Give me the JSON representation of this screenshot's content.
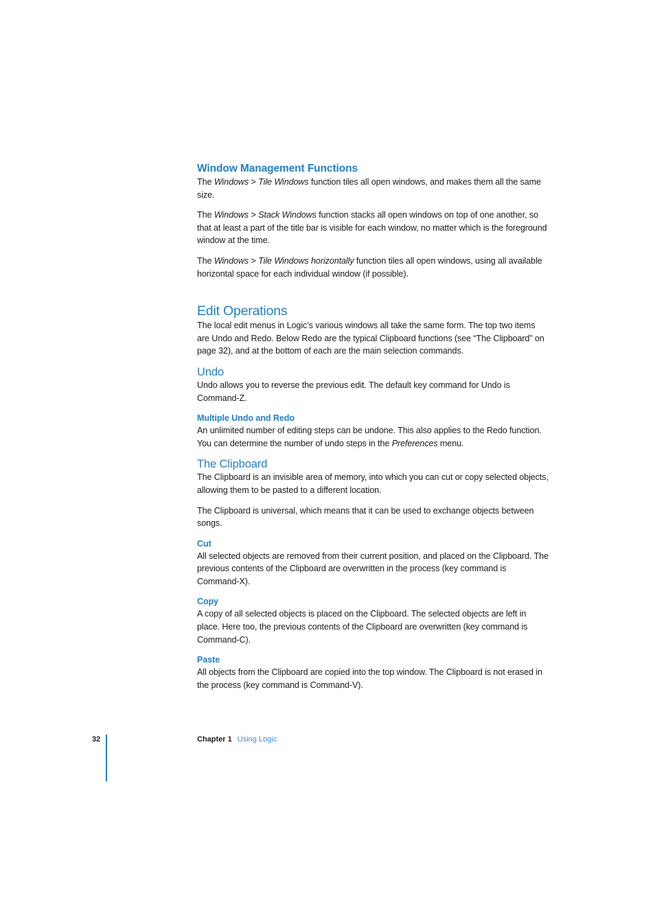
{
  "sections": {
    "window_mgmt": {
      "heading": "Window Management Functions",
      "p1": {
        "pre": "The ",
        "i1": "Windows",
        "mid": " > ",
        "i2": "Tile Windows",
        "post": " function tiles all open windows, and makes them all the same size."
      },
      "p2": {
        "pre": "The ",
        "i1": "Windows",
        "mid": " > ",
        "i2": "Stack Windows",
        "post": " function stacks all open windows on top of one another, so that at least a part of the title bar is visible for each window, no matter which is the foreground window at the time."
      },
      "p3": {
        "pre": "The ",
        "i1": "Windows",
        "mid": " > ",
        "i2": "Tile Windows horizontally",
        "post": " function tiles all open windows, using all available horizontal space for each individual window (if possible)."
      }
    },
    "edit_ops": {
      "heading": "Edit Operations",
      "body": "The local edit menus in Logic’s various windows all take the same form. The top two items are Undo and Redo. Below Redo are the typical Clipboard functions (see “The Clipboard” on page 32), and at the bottom of each are the main selection commands."
    },
    "undo": {
      "heading": "Undo",
      "body": "Undo allows you to reverse the previous edit. The default key command for Undo is Command-Z."
    },
    "multi_undo": {
      "heading": "Multiple Undo and Redo",
      "pre": "An unlimited number of editing steps can be undone. This also applies to the Redo function. You can determine the number of undo steps in the ",
      "italic": "Preferences",
      "post": " menu."
    },
    "clipboard": {
      "heading": "The Clipboard",
      "p1": "The Clipboard is an invisible area of memory, into which you can cut or copy selected objects, allowing them to be pasted to a different location.",
      "p2": "The Clipboard is universal, which means that it can be used to exchange objects between songs."
    },
    "cut": {
      "heading": "Cut",
      "body": "All selected objects are removed from their current position, and placed on the Clipboard. The previous contents of the Clipboard are overwritten in the process (key command is Command-X)."
    },
    "copy": {
      "heading": "Copy",
      "body": "A copy of all selected objects is placed on the Clipboard. The selected objects are left in place. Here too, the previous contents of the Clipboard are overwritten (key command is Command-C)."
    },
    "paste": {
      "heading": "Paste",
      "body": "All objects from the Clipboard are copied into the top window. The Clipboard is not erased in the process (key command is Command-V)."
    }
  },
  "footer": {
    "page_number": "32",
    "chapter_label": "Chapter 1",
    "chapter_title": "Using Logic"
  },
  "colors": {
    "heading": "#1f7fd0",
    "body_text": "#1a1a1a",
    "footer_rule": "#1f7fd0"
  }
}
